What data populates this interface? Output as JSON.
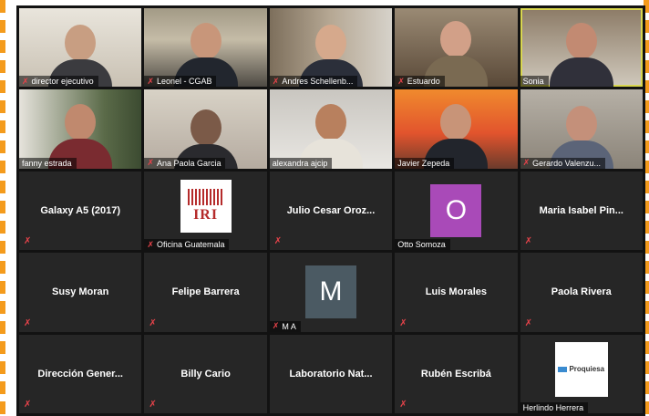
{
  "participants": [
    {
      "name": "director ejecutivo"
    },
    {
      "name": "Leonel - CGAB"
    },
    {
      "name": "Andres Schellenb..."
    },
    {
      "name": "Estuardo"
    },
    {
      "name": "Sonia"
    },
    {
      "name": "fanny estrada"
    },
    {
      "name": "Ana Paola Garcia"
    },
    {
      "name": "alexandra ajcip"
    },
    {
      "name": "Javier Zepeda"
    },
    {
      "name": "Gerardo Valenzu..."
    },
    {
      "center_name": "Galaxy A5 (2017)"
    },
    {
      "name": "Oficina Guatemala",
      "logo_text": "IRI"
    },
    {
      "center_name": "Julio Cesar Oroz..."
    },
    {
      "name": "Otto Somoza",
      "avatar_letter": "O"
    },
    {
      "center_name": "Maria Isabel Pin..."
    },
    {
      "center_name": "Susy Moran"
    },
    {
      "center_name": "Felipe Barrera"
    },
    {
      "name": "M A",
      "avatar_letter": "M"
    },
    {
      "center_name": "Luis Morales"
    },
    {
      "center_name": "Paola Rivera"
    },
    {
      "center_name": "Dirección Gener..."
    },
    {
      "center_name": "Billy Cario"
    },
    {
      "center_name": "Laboratorio Nat..."
    },
    {
      "center_name": "Rubén Escribá"
    },
    {
      "name": "Herlindo Herrera",
      "logo_text": "Proquiesa"
    }
  ],
  "icons": {
    "mic_muted": "microphone-muted-icon"
  },
  "colors": {
    "active_speaker": "#d8d64e",
    "muted": "#e8434a",
    "frame": "#f49b1c"
  }
}
